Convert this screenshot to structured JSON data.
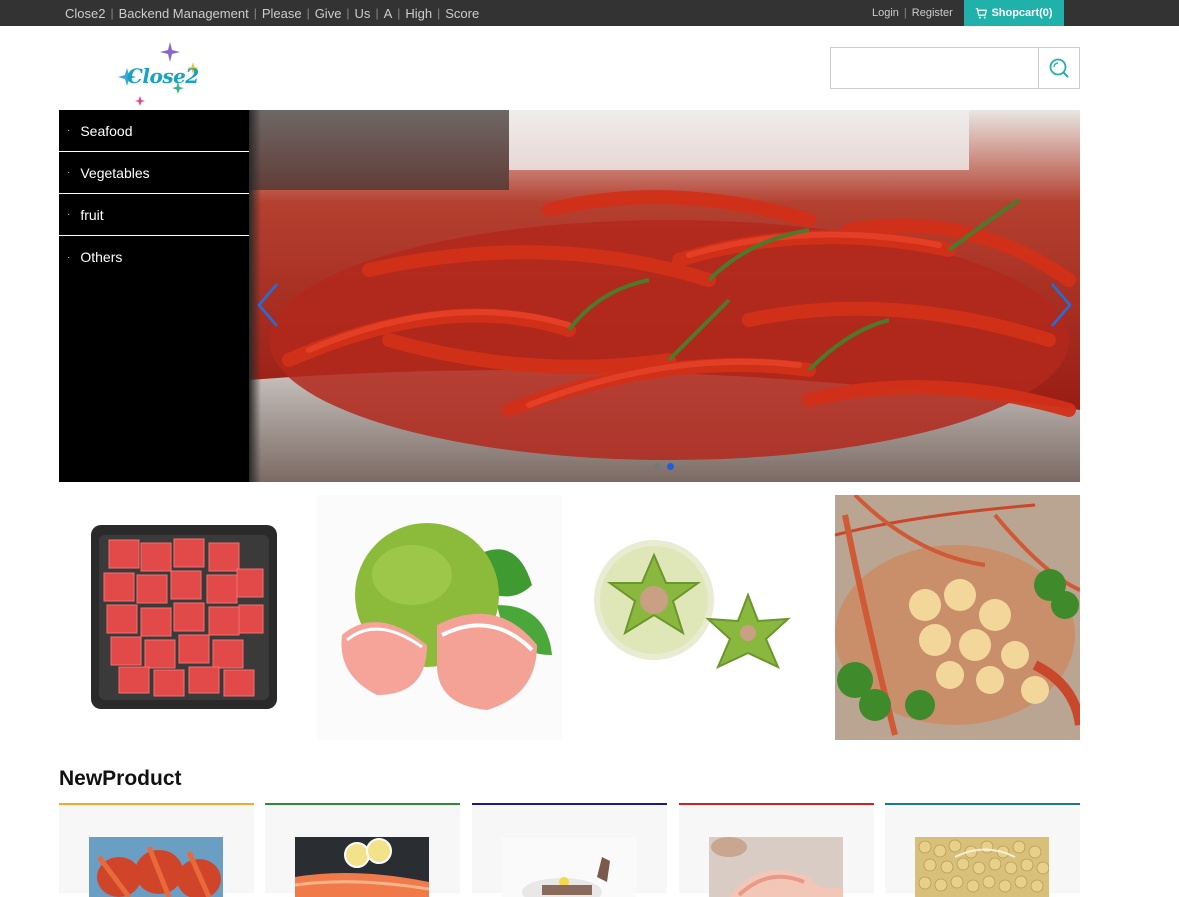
{
  "topbar": {
    "nav": [
      "Close2",
      "Backend Management",
      "Please",
      "Give",
      "Us",
      "A",
      "High",
      "Score"
    ],
    "login": "Login",
    "register": "Register",
    "cart": "Shopcart(0)"
  },
  "header": {
    "logo_text": "Close2",
    "search": {
      "value": "",
      "placeholder": ""
    }
  },
  "sidemenu": {
    "items": [
      "Seafood",
      "Vegetables",
      "fruit",
      "Others"
    ]
  },
  "banner": {
    "slide_count": 2,
    "active_slide": 2
  },
  "new_product": {
    "title": "NewProduct",
    "accent_colors": [
      "#f0a830",
      "#2d8a3a",
      "#1a1a8a",
      "#cc2222",
      "#1a7a8a"
    ]
  },
  "colors": {
    "topbar": "#333333",
    "accent": "#20b2aa"
  }
}
